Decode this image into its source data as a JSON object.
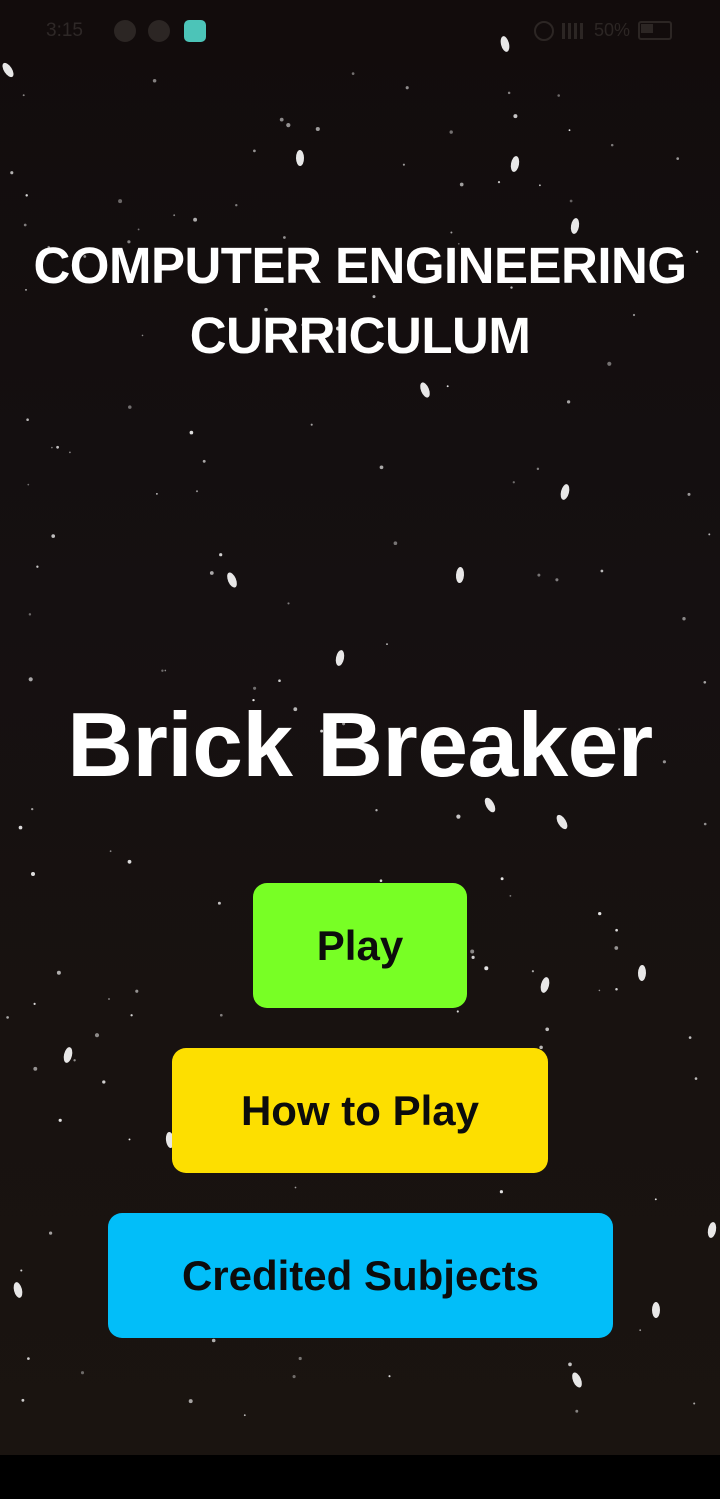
{
  "status_bar": {
    "time": "3:15",
    "battery": "50%"
  },
  "header": {
    "curriculum_line1": "COMPUTER ENGINEERING",
    "curriculum_line2": "CURRICULUM"
  },
  "game": {
    "title": "Brick Breaker"
  },
  "menu": {
    "play_label": "Play",
    "how_to_play_label": "How to Play",
    "credited_subjects_label": "Credited Subjects"
  },
  "colors": {
    "play_button": "#78ff25",
    "how_to_play_button": "#fddf00",
    "credited_subjects_button": "#02bef9",
    "background": "#150f0f"
  }
}
